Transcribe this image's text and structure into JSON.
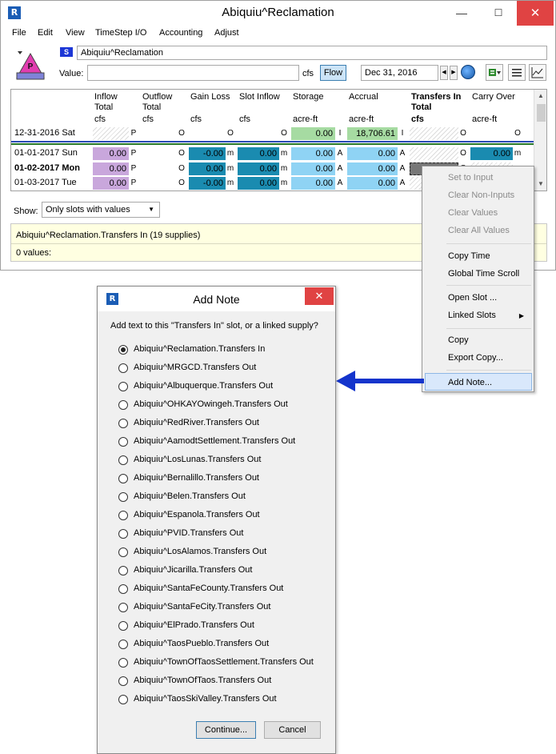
{
  "window": {
    "title": "Abiquiu^Reclamation",
    "menu": [
      "File",
      "Edit",
      "View",
      "TimeStep I/O",
      "Accounting",
      "Adjust"
    ],
    "controls": {
      "minimize": "—",
      "maximize": "☐",
      "close": "✕"
    }
  },
  "object": {
    "icon_letter": "P",
    "type_badge": "S",
    "name": "Abiquiu^Reclamation",
    "value_label": "Value:",
    "value": "",
    "units": "cfs",
    "flow_button": "Flow",
    "date": "Dec 31, 2016"
  },
  "table": {
    "columns": [
      {
        "line1": "Inflow",
        "line2": "Total",
        "units": "cfs",
        "bold": false
      },
      {
        "line1": "Outflow",
        "line2": "Total",
        "units": "cfs",
        "bold": false
      },
      {
        "line1": "Gain Loss",
        "line2": "",
        "units": "cfs",
        "bold": false
      },
      {
        "line1": "Slot Inflow",
        "line2": "",
        "units": "cfs",
        "bold": false
      },
      {
        "line1": "Storage",
        "line2": "",
        "units": "acre-ft",
        "bold": false
      },
      {
        "line1": "Accrual",
        "line2": "",
        "units": "acre-ft",
        "bold": false
      },
      {
        "line1": "Transfers In",
        "line2": "Total",
        "units": "cfs",
        "bold": true
      },
      {
        "line1": "Carry Over",
        "line2": "",
        "units": "acre-ft",
        "bold": false
      }
    ],
    "rows": [
      {
        "date": "12-31-2016 Sat",
        "bold": false,
        "values": [
          "",
          "",
          "",
          "",
          "0.00",
          "18,706.61",
          "",
          ""
        ],
        "flags": [
          "P",
          "O",
          "O",
          "O",
          "I",
          "I",
          "O",
          "O"
        ]
      },
      {
        "date": "01-01-2017 Sun",
        "bold": false,
        "values": [
          "0.00",
          "",
          "-0.00",
          "0.00",
          "0.00",
          "0.00",
          "",
          "0.00"
        ],
        "flags": [
          "P",
          "O",
          "m",
          "m",
          "A",
          "A",
          "O",
          "m"
        ]
      },
      {
        "date": "01-02-2017 Mon",
        "bold": true,
        "values": [
          "0.00",
          "",
          "0.00",
          "0.00",
          "0.00",
          "0.00",
          "",
          ""
        ],
        "flags": [
          "P",
          "O",
          "m",
          "m",
          "A",
          "A",
          "O",
          ""
        ]
      },
      {
        "date": "01-03-2017 Tue",
        "bold": false,
        "values": [
          "0.00",
          "",
          "-0.00",
          "0.00",
          "0.00",
          "0.00",
          "",
          ""
        ],
        "flags": [
          "P",
          "O",
          "m",
          "m",
          "A",
          "A",
          "",
          ""
        ]
      }
    ]
  },
  "show": {
    "label": "Show:",
    "selected": "Only slots with values"
  },
  "info": {
    "line1": "Abiquiu^Reclamation.Transfers In (19 supplies)",
    "line2": "0 values:"
  },
  "context_menu": {
    "items": [
      {
        "label": "Set to Input",
        "disabled": true
      },
      {
        "label": "Clear Non-Inputs",
        "disabled": true
      },
      {
        "label": "Clear Values",
        "disabled": true
      },
      {
        "label": "Clear All Values",
        "disabled": true
      },
      {
        "label": "Copy Time",
        "disabled": false
      },
      {
        "label": "Global Time Scroll",
        "disabled": false
      },
      {
        "label": "Open Slot ...",
        "disabled": false
      },
      {
        "label": "Linked Slots",
        "disabled": false,
        "submenu": true
      },
      {
        "label": "Copy",
        "disabled": false
      },
      {
        "label": "Export Copy...",
        "disabled": false
      },
      {
        "label": "Add Note...",
        "disabled": false,
        "highlighted": true
      }
    ]
  },
  "dialog": {
    "title": "Add Note",
    "close": "✕",
    "prompt": "Add text to this \"Transfers In\" slot, or a linked supply?",
    "options": [
      "Abiquiu^Reclamation.Transfers In",
      "Abiquiu^MRGCD.Transfers Out",
      "Abiquiu^Albuquerque.Transfers Out",
      "Abiquiu^OHKAYOwingeh.Transfers Out",
      "Abiquiu^RedRiver.Transfers Out",
      "Abiquiu^AamodtSettlement.Transfers Out",
      "Abiquiu^LosLunas.Transfers Out",
      "Abiquiu^Bernalillo.Transfers Out",
      "Abiquiu^Belen.Transfers Out",
      "Abiquiu^Espanola.Transfers Out",
      "Abiquiu^PVID.Transfers Out",
      "Abiquiu^LosAlamos.Transfers Out",
      "Abiquiu^Jicarilla.Transfers Out",
      "Abiquiu^SantaFeCounty.Transfers Out",
      "Abiquiu^SantaFeCity.Transfers Out",
      "Abiquiu^ElPrado.Transfers Out",
      "Abiquiu^TaosPueblo.Transfers Out",
      "Abiquiu^TownOfTaosSettlement.Transfers Out",
      "Abiquiu^TownOfTaos.Transfers Out",
      "Abiquiu^TaosSkiValley.Transfers Out"
    ],
    "selected_index": 0,
    "continue_label": "Continue...",
    "cancel_label": "Cancel"
  },
  "colors": {
    "purple_cell": "#c9a7dc",
    "teal_cell": "#1a8bb0",
    "lightblue_cell": "#8fd3f4",
    "green_cell": "#a6dba2",
    "hatch": "#e6e6e6",
    "arrow": "#1434cc"
  }
}
